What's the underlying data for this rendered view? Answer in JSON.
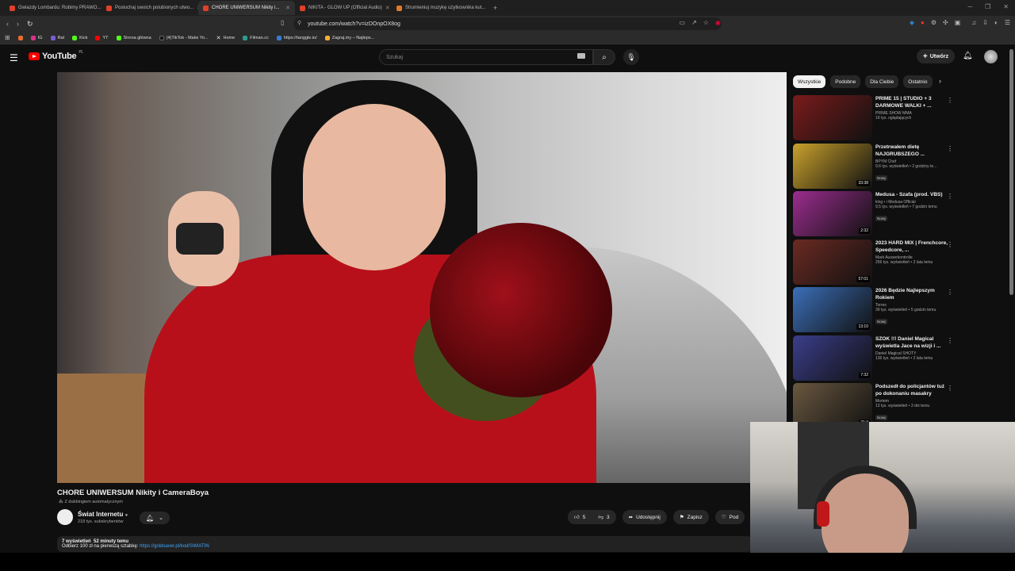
{
  "browser": {
    "tabs": [
      {
        "label": "Gwiazdy Lombardu: Robimy PRAWO..."
      },
      {
        "label": "Posłuchaj swoich polubionych utwo..."
      },
      {
        "label": "CHORE UNIWERSUM Nikity i..."
      },
      {
        "label": "NIKITA - GLOW UP (Official Audio)"
      },
      {
        "label": "Strumieniuj muzykę użytkownika kut..."
      }
    ],
    "new_tab": "+",
    "url": "youtube.com/watch?v=izDOnpOX8og",
    "bookmarks": [
      {
        "label": "IG"
      },
      {
        "label": "Rat"
      },
      {
        "label": "Kick"
      },
      {
        "label": "YT"
      },
      {
        "label": "Strona główna"
      },
      {
        "label": "(4)TikTok - Make Yo..."
      },
      {
        "label": "Home"
      },
      {
        "label": "Filman.cc"
      },
      {
        "label": "https://tanggle.io/"
      },
      {
        "label": "Zagraj.my – Najleps..."
      }
    ]
  },
  "youtube": {
    "logo_text": "YouTube",
    "region": "PL",
    "search_placeholder": "Szukaj",
    "create_label": "Utwórz",
    "video": {
      "title": "CHORE UNIWERSUM Nikity i CameraBoya",
      "dubbing": "Z dubbingiem automatycznym",
      "channel": "Świat Internetu",
      "subscribers": "218 tys. subskrybentów",
      "likes": "5",
      "dislikes": "3",
      "share": "Udostępnij",
      "save": "Zapisz",
      "more": "Pod",
      "views": "wyświetleń",
      "views_count": "7",
      "time_ago": "52 minuty temu",
      "desc_text": "Odbierz 100 zł na pierwszą sztabkę:",
      "desc_link": "https://goldsaver.pl/kod/SWIATIN"
    },
    "chips": [
      "Wszystkie",
      "Podobne",
      "Dla Ciebie",
      "Ostatnio"
    ],
    "recommendations": [
      {
        "title": "PRIME 15 | STUDIO + 3 DARMOWE WALKI + ...",
        "channel": "PRIME SHOW MMA",
        "meta": "19 tys. oglądających",
        "duration": "",
        "new": "",
        "thumb": "#7a1b1b"
      },
      {
        "title": "Przetrwałem dietę NAJGRUBSZEGO ...",
        "channel": "BPYM Chef",
        "meta": "9,6 tys. wyświetleń • 2 godziny te...",
        "duration": "33:38",
        "new": "Nowy",
        "thumb": "#c9a12c"
      },
      {
        "title": "Medusa - Szafa (prod. VBS)",
        "channel": "king • i Medusa Official",
        "meta": "9,5 tys. wyświetleń • 7 godzin temu",
        "duration": "2:32",
        "new": "Nowy",
        "thumb": "#9b2d8f"
      },
      {
        "title": "2023 HARD MIX | Frenchcore, Speedcore, ...",
        "channel": "Mark Ausserkontrolle",
        "meta": "256 tys. wyświetleń • 2 lata temu",
        "duration": "57:01",
        "new": "",
        "thumb": "#6b2a22"
      },
      {
        "title": "2026 Będzie Najlepszym Rokiem",
        "channel": "Torres",
        "meta": "39 tys. wyświetleń • 5 godzin temu",
        "duration": "13:10",
        "new": "Nowy",
        "thumb": "#3b6fb8"
      },
      {
        "title": "SZOK !!! Daniel Magical wyświetla Jace na wizji i ...",
        "channel": "Daniel Magical SHOTY",
        "meta": "136 tys. wyświetleń • 2 lata temu",
        "duration": "7:32",
        "new": "",
        "thumb": "#3a3e8a"
      },
      {
        "title": "Podszedł do policjantów tuż po dokonaniu masakry",
        "channel": "Mortem",
        "meta": "13 tys. wyświetleń • 3 dni temu",
        "duration": "21:3",
        "new": "Nowy",
        "thumb": "#6a5840"
      }
    ]
  }
}
